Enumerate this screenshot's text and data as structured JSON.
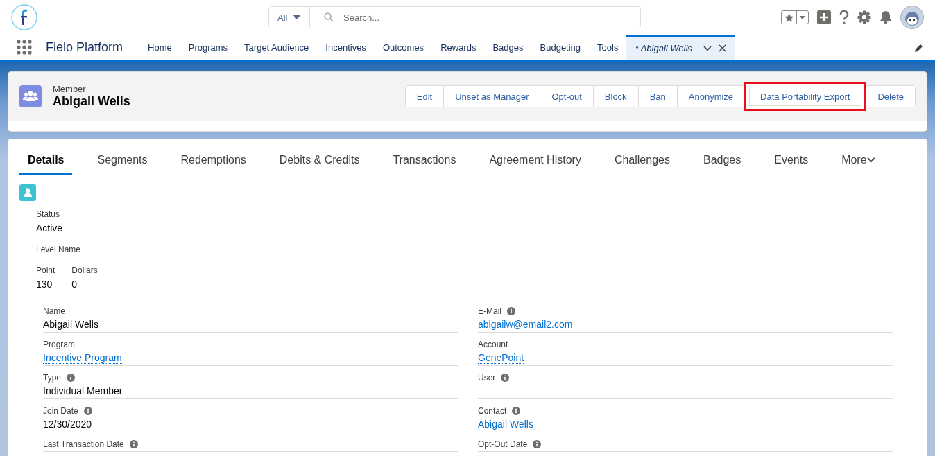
{
  "header": {
    "search": {
      "scope": "All",
      "placeholder": "Search..."
    }
  },
  "nav": {
    "app_name": "Fielo Platform",
    "items": [
      {
        "label": "Home",
        "selected": false
      },
      {
        "label": "Programs",
        "selected": false
      },
      {
        "label": "Target Audience",
        "selected": false
      },
      {
        "label": "Incentives",
        "selected": false
      },
      {
        "label": "Outcomes",
        "selected": false
      },
      {
        "label": "Rewards",
        "selected": false
      },
      {
        "label": "Badges",
        "selected": false
      },
      {
        "label": "Budgeting",
        "selected": false
      },
      {
        "label": "Tools",
        "selected": false
      }
    ],
    "open_tab": {
      "label": "* Abigail Wells",
      "selected": true
    }
  },
  "record": {
    "type": "Member",
    "name": "Abigail Wells",
    "actions": [
      {
        "label": "Edit",
        "highlighted": false
      },
      {
        "label": "Unset as Manager",
        "highlighted": false
      },
      {
        "label": "Opt-out",
        "highlighted": false
      },
      {
        "label": "Block",
        "highlighted": false
      },
      {
        "label": "Ban",
        "highlighted": false
      },
      {
        "label": "Anonymize",
        "highlighted": false
      },
      {
        "label": "Data Portability Export",
        "highlighted": true
      },
      {
        "label": "Delete",
        "highlighted": false
      }
    ]
  },
  "tabs": [
    {
      "label": "Details",
      "selected": true
    },
    {
      "label": "Segments",
      "selected": false
    },
    {
      "label": "Redemptions",
      "selected": false
    },
    {
      "label": "Debits & Credits",
      "selected": false
    },
    {
      "label": "Transactions",
      "selected": false
    },
    {
      "label": "Agreement History",
      "selected": false
    },
    {
      "label": "Challenges",
      "selected": false
    },
    {
      "label": "Badges",
      "selected": false
    },
    {
      "label": "Events",
      "selected": false
    },
    {
      "label": "More",
      "selected": false
    }
  ],
  "summary": {
    "status_label": "Status",
    "status": "Active",
    "level_label": "Level Name",
    "balances": [
      {
        "label": "Point",
        "value": "130"
      },
      {
        "label": "Dollars",
        "value": "0"
      }
    ]
  },
  "fields": [
    {
      "label": "Name",
      "value": "Abigail Wells",
      "kind": "text",
      "info": false
    },
    {
      "label": "E-Mail",
      "value": "abigailw@email2.com",
      "kind": "email",
      "info": true
    },
    {
      "label": "Program",
      "value": "Incentive Program",
      "kind": "link",
      "info": false
    },
    {
      "label": "Account",
      "value": "GenePoint",
      "kind": "link",
      "info": false
    },
    {
      "label": "Type",
      "value": "Individual Member",
      "kind": "text",
      "info": true
    },
    {
      "label": "User",
      "info": true
    },
    {
      "label": "Join Date",
      "value": "12/30/2020",
      "kind": "text",
      "info": true
    },
    {
      "label": "Contact",
      "value": "Abigail Wells",
      "kind": "link",
      "info": true
    },
    {
      "label": "Last Transaction Date",
      "info": true
    },
    {
      "label": "Opt-Out Date",
      "info": true
    }
  ]
}
